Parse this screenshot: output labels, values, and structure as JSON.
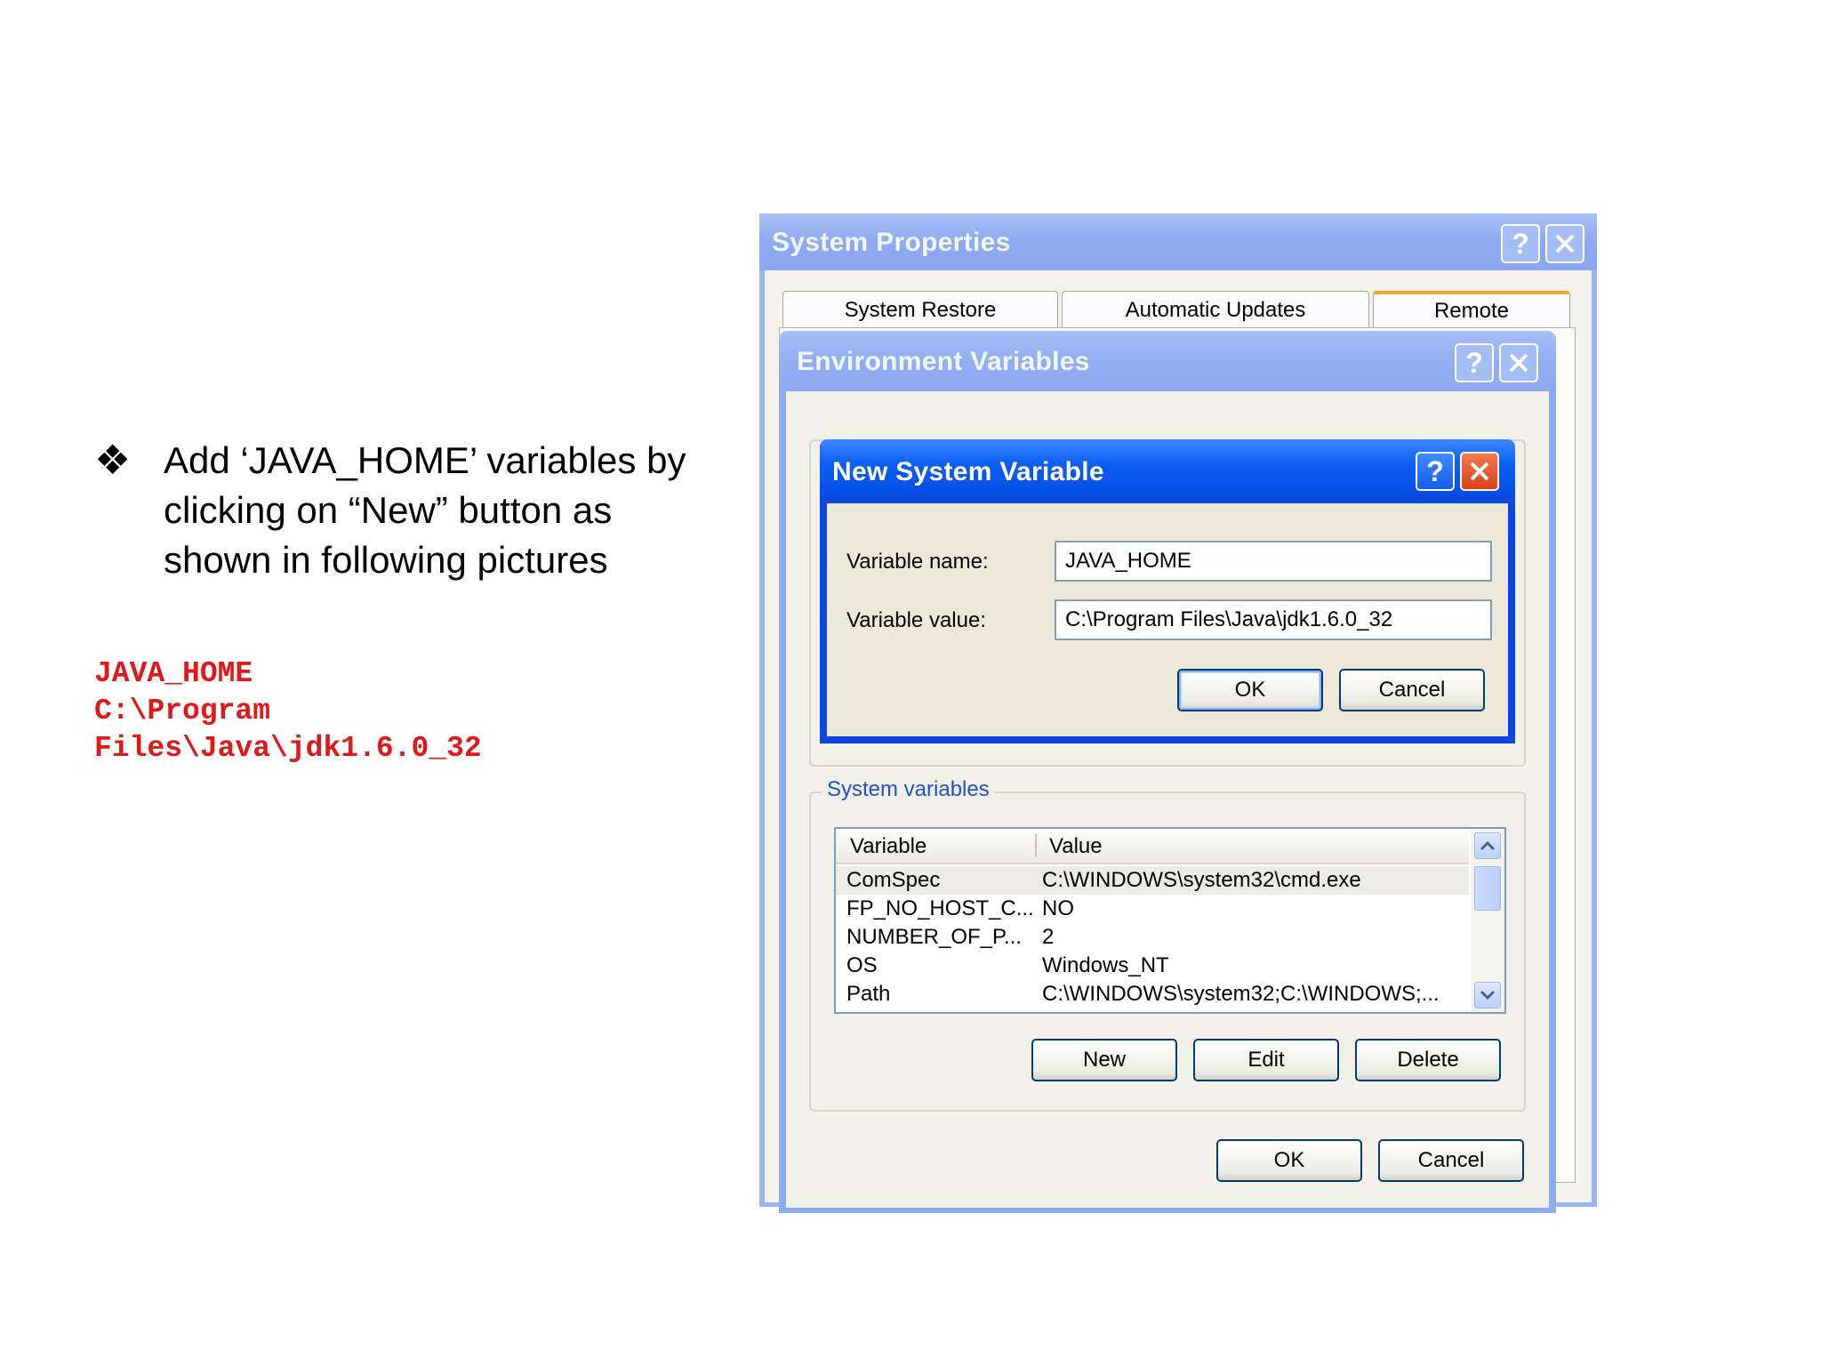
{
  "slide": {
    "bullet_glyph": "❖",
    "bullet_lines": [
      "Add ‘JAVA_HOME’ variables by",
      "clicking on “New” button as",
      "shown in following pictures"
    ],
    "code_lines": [
      "JAVA_HOME",
      "C:\\Program",
      "Files\\Java\\jdk1.6.0_32"
    ]
  },
  "system_properties": {
    "title": "System Properties",
    "tabs": [
      "System Restore",
      "Automatic Updates",
      "Remote"
    ],
    "active_tab": "Remote"
  },
  "environment_variables": {
    "title": "Environment Variables",
    "group_label": "System variables",
    "columns": [
      "Variable",
      "Value"
    ],
    "rows": [
      {
        "variable": "ComSpec",
        "value": "C:\\WINDOWS\\system32\\cmd.exe"
      },
      {
        "variable": "FP_NO_HOST_C...",
        "value": "NO"
      },
      {
        "variable": "NUMBER_OF_P...",
        "value": "2"
      },
      {
        "variable": "OS",
        "value": "Windows_NT"
      },
      {
        "variable": "Path",
        "value": "C:\\WINDOWS\\system32;C:\\WINDOWS;..."
      }
    ],
    "buttons": {
      "new": "New",
      "edit": "Edit",
      "delete": "Delete",
      "ok": "OK",
      "cancel": "Cancel"
    }
  },
  "new_system_variable": {
    "title": "New System Variable",
    "name_label": "Variable name:",
    "value_label": "Variable value:",
    "name_value": "JAVA_HOME",
    "value_value": "C:\\Program Files\\Java\\jdk1.6.0_32",
    "buttons": {
      "ok": "OK",
      "cancel": "Cancel"
    }
  },
  "colors": {
    "code_text": "#e01818",
    "active_titlebar": "#0a5ef2",
    "inactive_titlebar": "#93aef2",
    "close_button": "#e0491e",
    "group_label": "#1f52c8"
  }
}
